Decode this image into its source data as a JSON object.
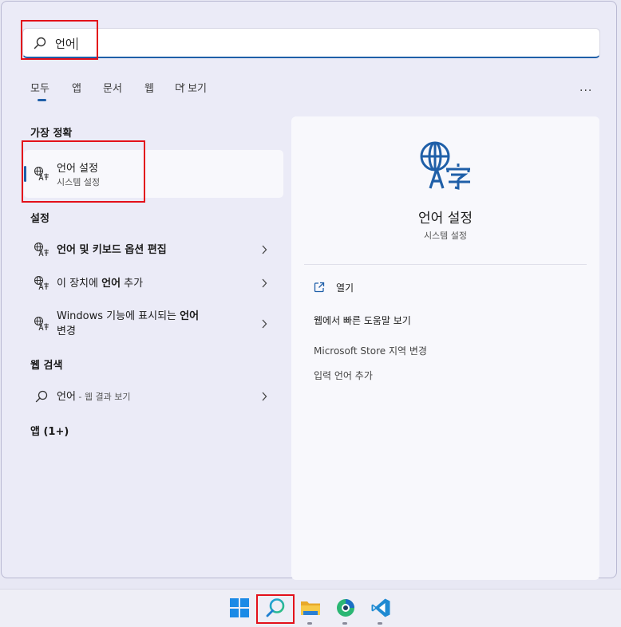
{
  "search": {
    "query": "언어"
  },
  "filters": {
    "items": [
      "모두",
      "앱",
      "문서",
      "웹",
      "더 보기"
    ],
    "more_menu": "..."
  },
  "sections": {
    "best_match": "가장 정확",
    "settings": "설정",
    "web_search": "웹 검색",
    "apps": "앱 (1+)"
  },
  "best_match_item": {
    "title": "언어 설정",
    "subtitle": "시스템 설정"
  },
  "settings_items": [
    {
      "label": "언어 및 키보드 옵션 편집"
    },
    {
      "label_pre": "이 장치에 ",
      "label_bold": "언어",
      "label_post": " 추가"
    },
    {
      "label_pre": "Windows 기능에 표시되는 ",
      "label_bold": "언어",
      "label_line2": "변경"
    }
  ],
  "web_item": {
    "query": "언어",
    "suffix": " - 웹 결과 보기"
  },
  "detail": {
    "title": "언어 설정",
    "subtitle": "시스템 설정",
    "actions": [
      "열기",
      "웹에서 빠른 도움말 보기",
      "Microsoft Store 지역 변경",
      "입력 언어 추가"
    ]
  },
  "taskbar": {
    "icons": [
      "windows-start-icon",
      "search-icon",
      "file-explorer-icon",
      "browser-icon",
      "vscode-icon"
    ]
  },
  "colors": {
    "accent": "#1f5fa8",
    "highlight": "#e3101a",
    "panel": "#ebebf7"
  }
}
